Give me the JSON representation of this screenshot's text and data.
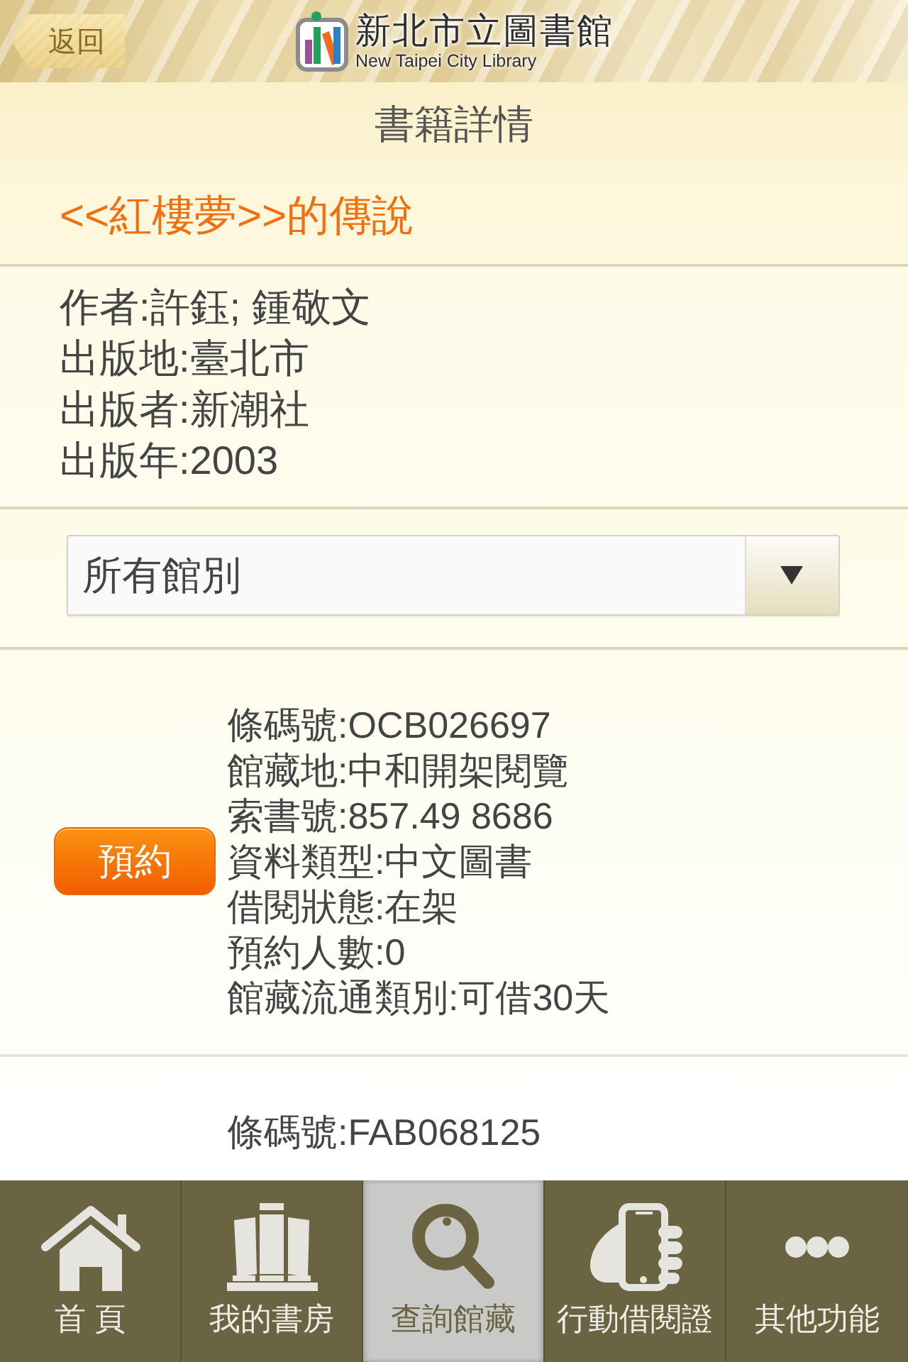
{
  "header": {
    "back_button": "返回",
    "logo": {
      "name": "新北市立圖書館",
      "subtitle": "New Taipei City Library"
    }
  },
  "title_bar": {
    "title": "書籍詳情"
  },
  "book": {
    "title": "<<紅樓夢>>的傳說",
    "details": [
      "作者:許鈺; 鍾敬文",
      "出版地:臺北市",
      "出版者:新潮社",
      "出版年:2003"
    ]
  },
  "branch_select": {
    "value": "所有館別"
  },
  "holdings": [
    {
      "button": "預約",
      "fields": [
        "條碼號:OCB026697",
        "館藏地:中和開架閱覽",
        "索書號:857.49 8686",
        "資料類型:中文圖書",
        "借閱狀態:在架",
        "預約人數:0",
        "館藏流通類別:可借30天"
      ]
    },
    {
      "fields": [
        "條碼號:FAB068125"
      ]
    }
  ],
  "tab_bar": [
    {
      "label": "首 頁",
      "selected": false
    },
    {
      "label": "我的書房",
      "selected": false
    },
    {
      "label": "查詢館藏",
      "selected": true
    },
    {
      "label": "行動借閱證",
      "selected": false
    },
    {
      "label": "其他功能",
      "selected": false
    }
  ]
}
